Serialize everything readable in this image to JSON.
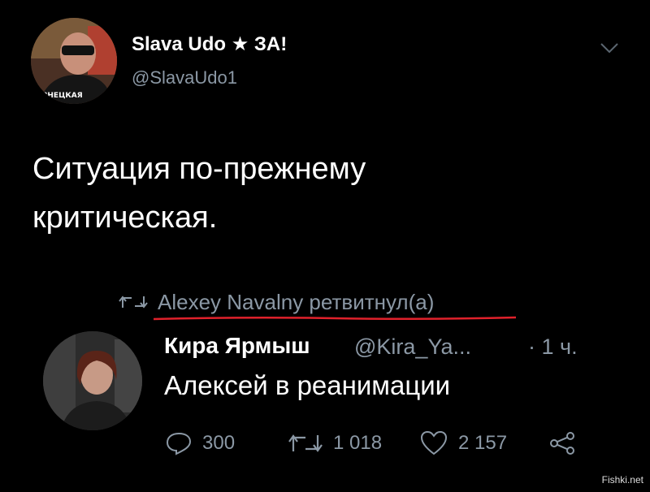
{
  "tweet": {
    "author": {
      "display_name": "Slava Udo ★ ЗА!",
      "handle": "@SlavaUdo1",
      "avatar_shirt_text": "ЗНЕЦКАЯ"
    },
    "text_line1": "Ситуация по-прежнему",
    "text_line2": "критическая.",
    "menu_icon": "chevron-down-icon"
  },
  "retweet_context": {
    "label": "Alexey Navalny ретвитнул(а)",
    "icon": "retweet-icon",
    "underline_color": "#e0212b"
  },
  "retweeted": {
    "display_name": "Кира Ярмыш",
    "handle": "@Kira_Ya...",
    "time": "· 1 ч.",
    "text": "Алексей в реанимации"
  },
  "actions": {
    "replies": "300",
    "retweets": "1 018",
    "likes": "2 157"
  },
  "watermark": "Fishki.net",
  "colors": {
    "background": "#000000",
    "secondary_text": "#8b98a5",
    "primary_text": "#ffffff"
  }
}
